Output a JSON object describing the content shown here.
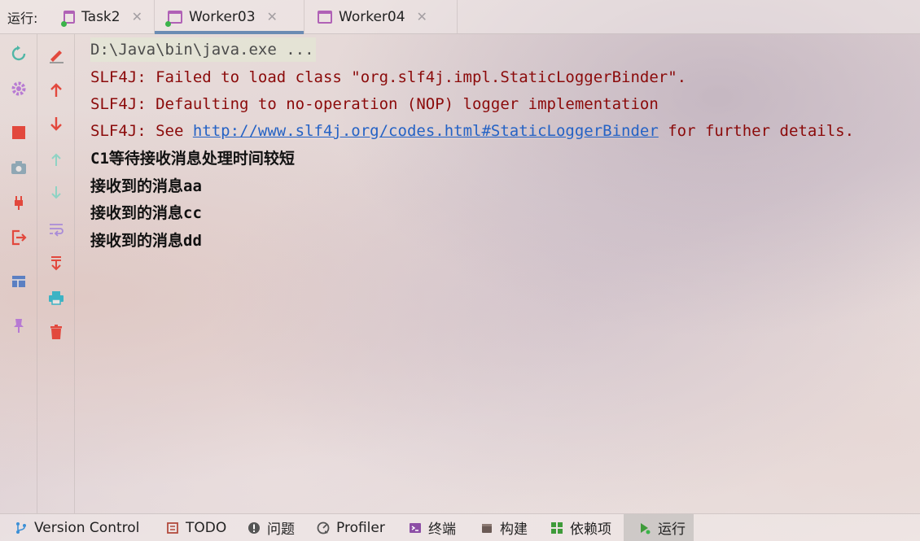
{
  "tabbar": {
    "run_label": "运行:",
    "tabs": [
      {
        "label": "Task2",
        "active": false
      },
      {
        "label": "Worker03",
        "active": true
      },
      {
        "label": "Worker04",
        "active": false
      }
    ]
  },
  "toolbar_left": [
    "rerun-icon",
    "settings-icon",
    "stop-icon",
    "screenshot-icon",
    "attach-debugger-icon",
    "exit-icon",
    "layout-icon",
    "pin-icon"
  ],
  "toolbar_right": [
    "clear-icon",
    "up-arrow-icon",
    "down-arrow-icon",
    "up-stack-icon",
    "down-stack-icon",
    "soft-wrap-icon",
    "scroll-to-end-icon",
    "print-icon",
    "trash-icon"
  ],
  "console": {
    "command": "D:\\Java\\bin\\java.exe ...",
    "errors": [
      "SLF4J: Failed to load class \"org.slf4j.impl.StaticLoggerBinder\".",
      "SLF4J: Defaulting to no-operation (NOP) logger implementation"
    ],
    "see_prefix": "SLF4J: See ",
    "see_link": "http://www.slf4j.org/codes.html#StaticLoggerBinder",
    "see_suffix": " for further details.",
    "output": [
      "C1等待接收消息处理时间较短",
      "接收到的消息aa",
      "接收到的消息cc",
      "接收到的消息dd"
    ]
  },
  "bottombar": {
    "items": [
      {
        "label": "Version Control",
        "icon": "branch-icon"
      },
      {
        "label": "TODO",
        "icon": "todo-icon"
      },
      {
        "label": "问题",
        "icon": "problems-icon"
      },
      {
        "label": "Profiler",
        "icon": "profiler-icon"
      },
      {
        "label": "终端",
        "icon": "terminal-icon"
      },
      {
        "label": "构建",
        "icon": "build-icon"
      },
      {
        "label": "依赖项",
        "icon": "dependencies-icon"
      },
      {
        "label": "运行",
        "icon": "run-icon"
      }
    ]
  },
  "colors": {
    "error": "#8b0a0a",
    "link": "#2462c5",
    "tab_accent": "#6b8bb3",
    "tab_icon": "#b061b6"
  }
}
